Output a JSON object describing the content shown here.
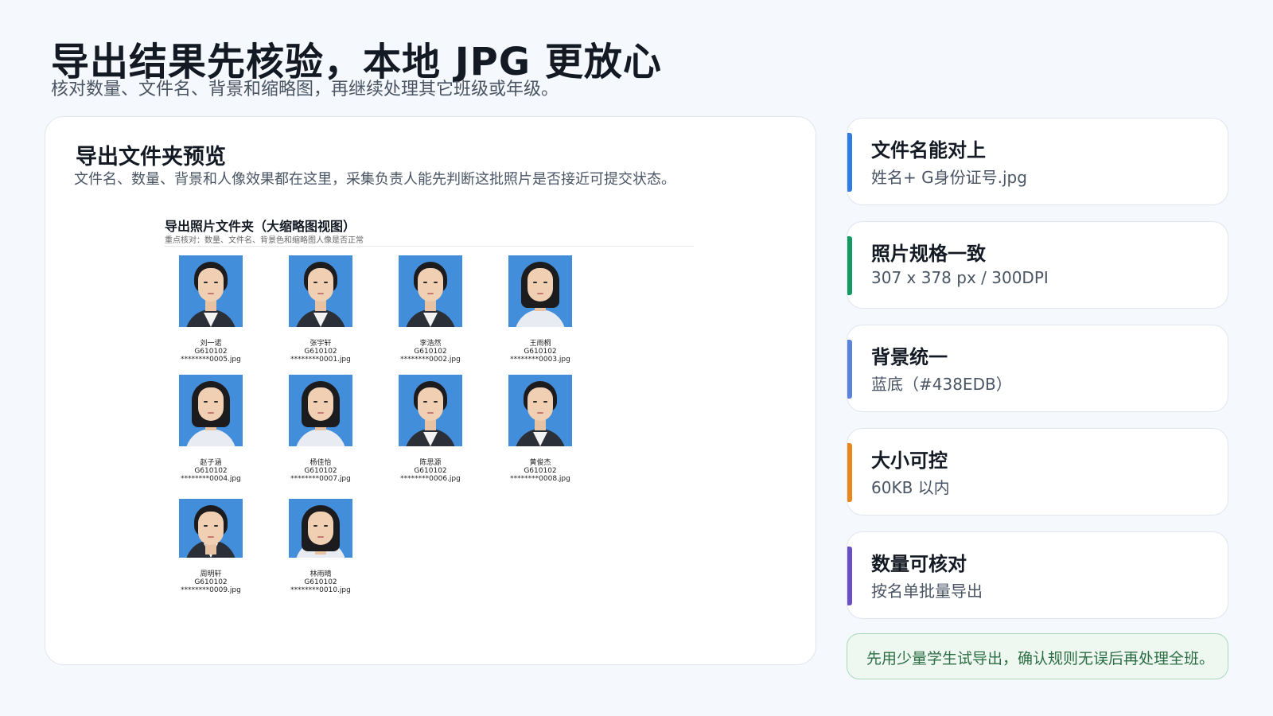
{
  "header": {
    "title": "导出结果先核验，本地 JPG 更放心",
    "subtitle": "核对数量、文件名、背景和缩略图，再继续处理其它班级或年级。"
  },
  "preview": {
    "title": "导出文件夹预览",
    "description": "文件名、数量、背景和人像效果都在这里，采集负责人能先判断这批照片是否接近可提交状态。",
    "folder_title": "导出照片文件夹（大缩略图视图）",
    "folder_subtitle": "重点核对：数量、文件名、背景色和缩略图人像是否正常",
    "background_color": "#438EDB",
    "photos": [
      {
        "name": "刘一诺",
        "class": "G610102",
        "file": "********0005.jpg",
        "gender": "boy"
      },
      {
        "name": "张宇轩",
        "class": "G610102",
        "file": "********0001.jpg",
        "gender": "boy"
      },
      {
        "name": "李浩然",
        "class": "G610102",
        "file": "********0002.jpg",
        "gender": "boy"
      },
      {
        "name": "王雨桐",
        "class": "G610102",
        "file": "********0003.jpg",
        "gender": "girl"
      },
      {
        "name": "赵子涵",
        "class": "G610102",
        "file": "********0004.jpg",
        "gender": "girl"
      },
      {
        "name": "杨佳怡",
        "class": "G610102",
        "file": "********0007.jpg",
        "gender": "girl"
      },
      {
        "name": "陈思源",
        "class": "G610102",
        "file": "********0006.jpg",
        "gender": "boy"
      },
      {
        "name": "黄俊杰",
        "class": "G610102",
        "file": "********0008.jpg",
        "gender": "boy"
      },
      {
        "name": "周明轩",
        "class": "G610102",
        "file": "********0009.jpg",
        "gender": "boy"
      },
      {
        "name": "林雨晴",
        "class": "G610102",
        "file": "********0010.jpg",
        "gender": "girl"
      }
    ]
  },
  "checks": [
    {
      "title": "文件名能对上",
      "value": "姓名+ G身份证号.jpg",
      "accent": "#2f7de1"
    },
    {
      "title": "照片规格一致",
      "value": "307 x 378 px / 300DPI",
      "accent": "#139a63"
    },
    {
      "title": "背景统一",
      "value": "蓝底（#438EDB）",
      "accent": "#5a83e0"
    },
    {
      "title": "大小可控",
      "value": "60KB 以内",
      "accent": "#e8871c"
    },
    {
      "title": "数量可核对",
      "value": "按名单批量导出",
      "accent": "#6a4fc9"
    }
  ],
  "tip": {
    "text": "先用少量学生试导出，确认规则无误后再处理全班。"
  }
}
